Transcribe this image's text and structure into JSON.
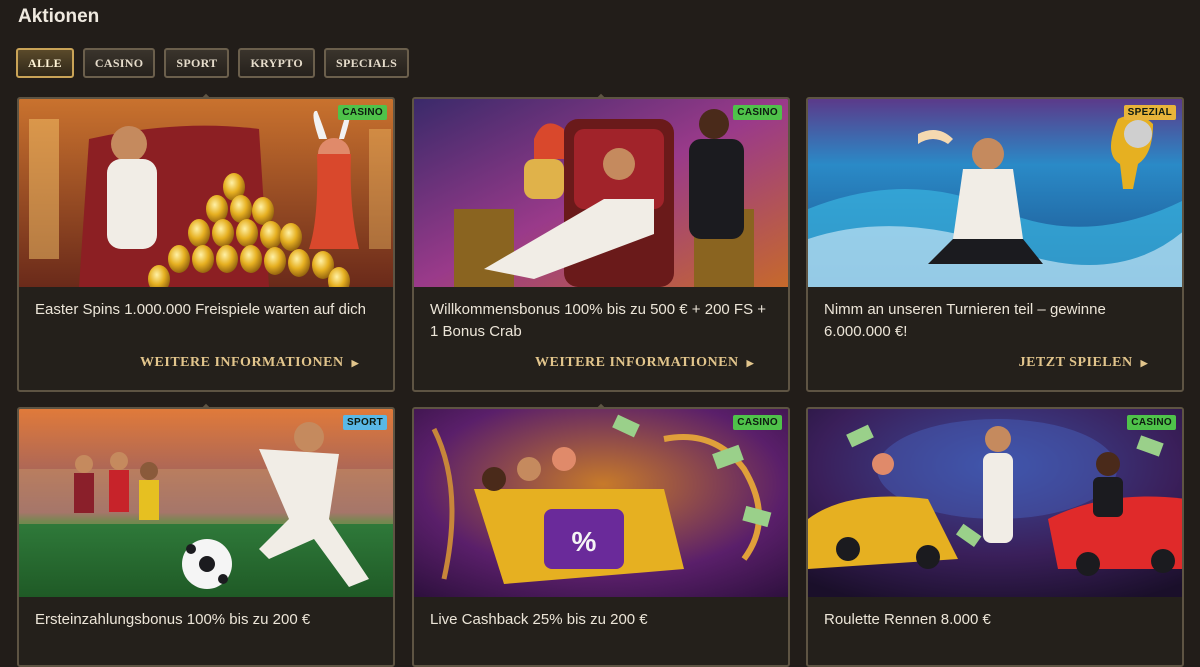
{
  "page": {
    "title": "Aktionen"
  },
  "filters": [
    {
      "label": "ALLE",
      "active": true
    },
    {
      "label": "CASINO",
      "active": false
    },
    {
      "label": "SPORT",
      "active": false
    },
    {
      "label": "KRYPTO",
      "active": false
    },
    {
      "label": "SPECIALS",
      "active": false
    }
  ],
  "cards": [
    {
      "badge": "CASINO",
      "badge_color": "#4fc24a",
      "text": "Easter Spins 1.000.000 Freispiele warten auf dich",
      "cta": "WEITERE INFORMATIONEN"
    },
    {
      "badge": "CASINO",
      "badge_color": "#4fc24a",
      "text": "Willkommensbonus 100% bis zu 500 € + 200 FS + 1 Bonus Crab",
      "cta": "WEITERE INFORMATIONEN"
    },
    {
      "badge": "SPEZIAL",
      "badge_color": "#e8b43a",
      "text": "Nimm an unseren Turnieren teil – gewinne 6.000.000 €!",
      "cta": "JETZT SPIELEN"
    },
    {
      "badge": "SPORT",
      "badge_color": "#59b8e6",
      "text": "Ersteinzahlungsbonus 100% bis zu 200 €",
      "cta": ""
    },
    {
      "badge": "CASINO",
      "badge_color": "#4fc24a",
      "text": "Live Cashback 25% bis zu 200 €",
      "cta": ""
    },
    {
      "badge": "CASINO",
      "badge_color": "#4fc24a",
      "text": "Roulette Rennen 8.000 €",
      "cta": ""
    }
  ]
}
